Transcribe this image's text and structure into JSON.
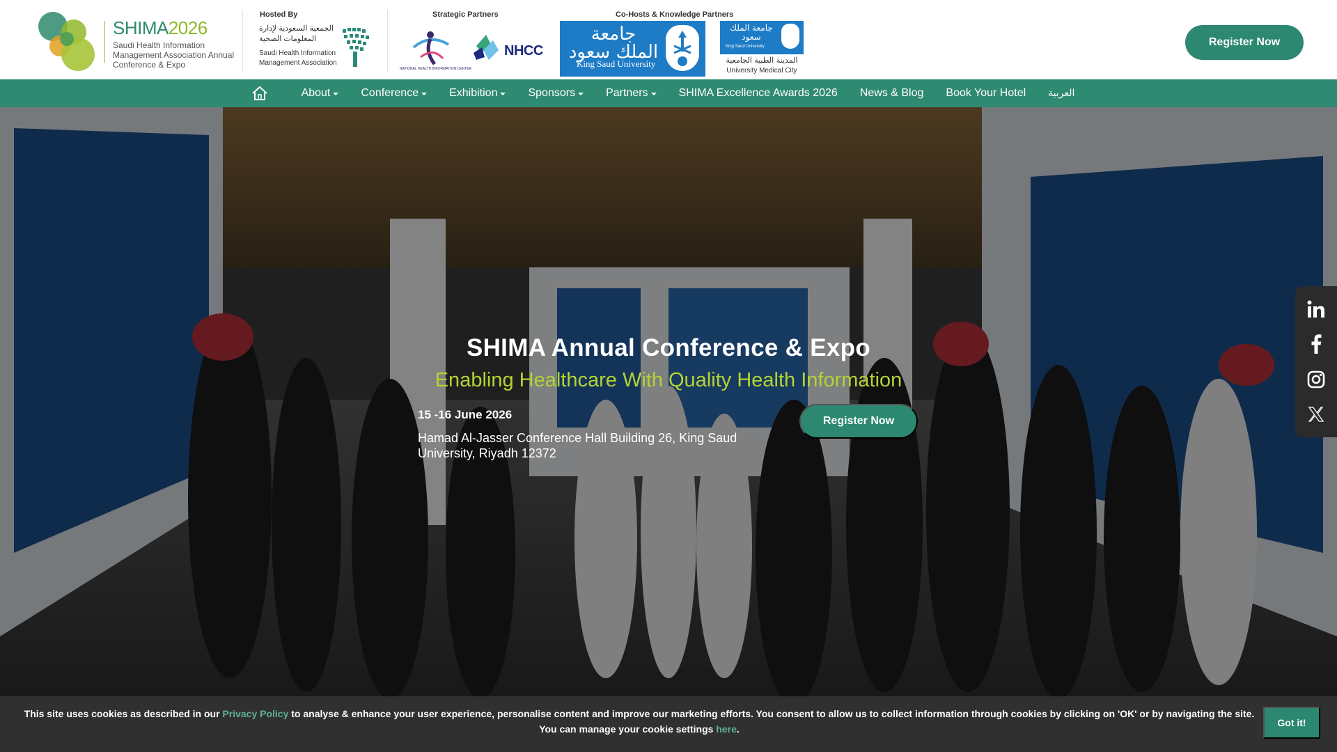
{
  "brand": {
    "title_shima": "SHIMA",
    "title_year": "2026",
    "subtitle": "Saudi Health Information Management Association Annual Conference & Expo"
  },
  "partners": {
    "hosted_by_label": "Hosted By",
    "strategic_label": "Strategic Partners",
    "cohosts_label": "Co-Hosts & Knowledge Partners",
    "sham_arabic": "الجمعية السعودية لإدارة المعلومات الصحية",
    "sham_english": "Saudi Health Information Management Association",
    "nhic_caption": "NATIONAL HEALTH INFORMATION CENTER",
    "nhcc_name": "NHCC",
    "ksu_arabic": "جامعة الملك سعود",
    "ksu_english": "King Saud University",
    "kumc_arabic": "جامعة الملك سعود",
    "kumc_small_english": "King Saud University",
    "kumc_arabic_2": "المدينة الطبية الجامعية",
    "kumc_english": "University Medical City"
  },
  "header": {
    "register_label": "Register Now"
  },
  "nav": {
    "home_icon": "home-icon",
    "items": [
      {
        "label": "About",
        "dropdown": true
      },
      {
        "label": "Conference",
        "dropdown": true
      },
      {
        "label": "Exhibition",
        "dropdown": true
      },
      {
        "label": "Sponsors",
        "dropdown": true
      },
      {
        "label": "Partners",
        "dropdown": true
      },
      {
        "label": "SHIMA Excellence Awards 2026",
        "dropdown": false
      },
      {
        "label": "News & Blog",
        "dropdown": false
      },
      {
        "label": "Book Your Hotel",
        "dropdown": false
      },
      {
        "label": "العربية",
        "dropdown": false
      }
    ]
  },
  "hero": {
    "title": "SHIMA Annual Conference & Expo",
    "tagline": "Enabling Healthcare With Quality Health Information",
    "date": "15 -16 June 2026",
    "venue": "Hamad Al-Jasser Conference Hall Building 26, King Saud University, Riyadh 12372",
    "register_label": "Register Now"
  },
  "social": [
    "linkedin-icon",
    "facebook-icon",
    "instagram-icon",
    "x-icon"
  ],
  "cookie": {
    "text_before": "This site uses cookies as described in our ",
    "privacy_link": "Privacy Policy",
    "text_middle": " to analyse & enhance your user experience, personalise content and improve our marketing efforts. You consent to allow us to collect information through cookies by clicking on 'OK' or by navigating the site. You can manage your cookie settings ",
    "here_link": "here",
    "text_after": ".",
    "button_label": "Got it!"
  },
  "colors": {
    "primary_green": "#2f8a72",
    "accent_lime": "#b4d333",
    "ksu_blue": "#1e7bc6",
    "cookie_bg": "#303030"
  }
}
